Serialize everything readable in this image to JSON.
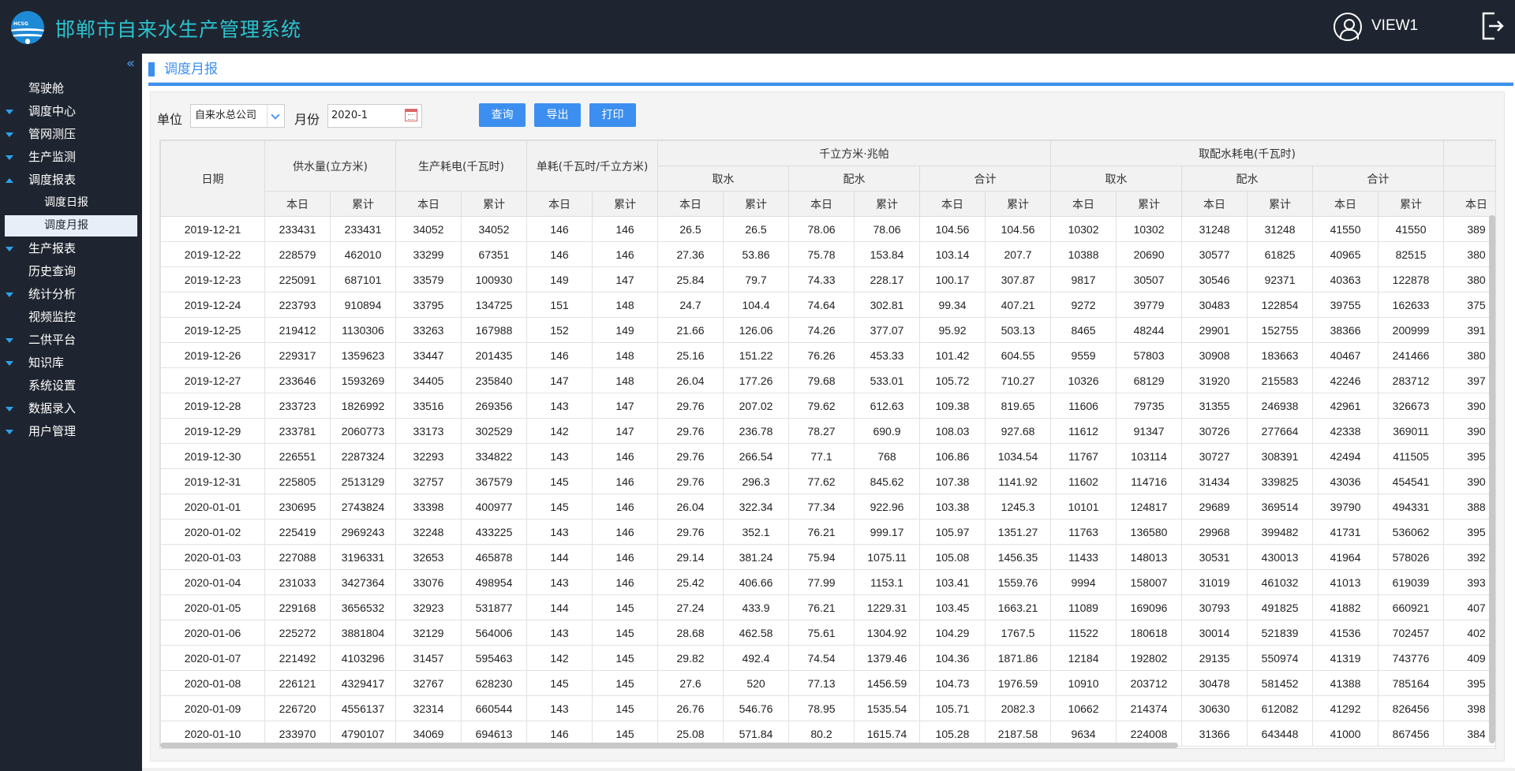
{
  "header": {
    "title": "邯郸市自来水生产管理系统",
    "logo_text": "HCSG",
    "user": "VIEW1"
  },
  "sidebar": {
    "collapse_glyph": "«",
    "items": [
      {
        "label": "驾驶舱",
        "arrow": "none"
      },
      {
        "label": "调度中心",
        "arrow": "down"
      },
      {
        "label": "管网测压",
        "arrow": "down"
      },
      {
        "label": "生产监测",
        "arrow": "down"
      },
      {
        "label": "调度报表",
        "arrow": "up"
      },
      {
        "label": "调度日报",
        "sub": true
      },
      {
        "label": "调度月报",
        "sub": true,
        "active": true
      },
      {
        "label": "生产报表",
        "arrow": "down"
      },
      {
        "label": "历史查询",
        "arrow": "none"
      },
      {
        "label": "统计分析",
        "arrow": "down"
      },
      {
        "label": "视频监控",
        "arrow": "none"
      },
      {
        "label": "二供平台",
        "arrow": "down"
      },
      {
        "label": "知识库",
        "arrow": "down"
      },
      {
        "label": "系统设置",
        "arrow": "none"
      },
      {
        "label": "数据录入",
        "arrow": "down"
      },
      {
        "label": "用户管理",
        "arrow": "down"
      }
    ]
  },
  "page": {
    "title": "调度月报"
  },
  "toolbar": {
    "unit_label": "单位",
    "unit_value": "自来水总公司",
    "month_label": "月份",
    "month_value": "2020-1",
    "query_btn": "查询",
    "export_btn": "导出",
    "print_btn": "打印"
  },
  "table": {
    "h1": {
      "date": "日期",
      "supply": "供水量(立方米)",
      "power": "生产耗电(千瓦时)",
      "unit_cons": "单耗(千瓦时/千立方米)",
      "kvm": "千立方米·兆帕",
      "water_power": "取配水耗电(千瓦时)"
    },
    "h2": {
      "take": "取水",
      "dist": "配水",
      "total": "合计"
    },
    "h3": {
      "day": "本日",
      "cum": "累计"
    },
    "rows": [
      [
        "2019-12-21",
        "233431",
        "233431",
        "34052",
        "34052",
        "146",
        "146",
        "26.5",
        "26.5",
        "78.06",
        "78.06",
        "104.56",
        "104.56",
        "10302",
        "10302",
        "31248",
        "31248",
        "41550",
        "41550",
        "389"
      ],
      [
        "2019-12-22",
        "228579",
        "462010",
        "33299",
        "67351",
        "146",
        "146",
        "27.36",
        "53.86",
        "75.78",
        "153.84",
        "103.14",
        "207.7",
        "10388",
        "20690",
        "30577",
        "61825",
        "40965",
        "82515",
        "380"
      ],
      [
        "2019-12-23",
        "225091",
        "687101",
        "33579",
        "100930",
        "149",
        "147",
        "25.84",
        "79.7",
        "74.33",
        "228.17",
        "100.17",
        "307.87",
        "9817",
        "30507",
        "30546",
        "92371",
        "40363",
        "122878",
        "380"
      ],
      [
        "2019-12-24",
        "223793",
        "910894",
        "33795",
        "134725",
        "151",
        "148",
        "24.7",
        "104.4",
        "74.64",
        "302.81",
        "99.34",
        "407.21",
        "9272",
        "39779",
        "30483",
        "122854",
        "39755",
        "162633",
        "375"
      ],
      [
        "2019-12-25",
        "219412",
        "1130306",
        "33263",
        "167988",
        "152",
        "149",
        "21.66",
        "126.06",
        "74.26",
        "377.07",
        "95.92",
        "503.13",
        "8465",
        "48244",
        "29901",
        "152755",
        "38366",
        "200999",
        "391"
      ],
      [
        "2019-12-26",
        "229317",
        "1359623",
        "33447",
        "201435",
        "146",
        "148",
        "25.16",
        "151.22",
        "76.26",
        "453.33",
        "101.42",
        "604.55",
        "9559",
        "57803",
        "30908",
        "183663",
        "40467",
        "241466",
        "380"
      ],
      [
        "2019-12-27",
        "233646",
        "1593269",
        "34405",
        "235840",
        "147",
        "148",
        "26.04",
        "177.26",
        "79.68",
        "533.01",
        "105.72",
        "710.27",
        "10326",
        "68129",
        "31920",
        "215583",
        "42246",
        "283712",
        "397"
      ],
      [
        "2019-12-28",
        "233723",
        "1826992",
        "33516",
        "269356",
        "143",
        "147",
        "29.76",
        "207.02",
        "79.62",
        "612.63",
        "109.38",
        "819.65",
        "11606",
        "79735",
        "31355",
        "246938",
        "42961",
        "326673",
        "390"
      ],
      [
        "2019-12-29",
        "233781",
        "2060773",
        "33173",
        "302529",
        "142",
        "147",
        "29.76",
        "236.78",
        "78.27",
        "690.9",
        "108.03",
        "927.68",
        "11612",
        "91347",
        "30726",
        "277664",
        "42338",
        "369011",
        "390"
      ],
      [
        "2019-12-30",
        "226551",
        "2287324",
        "32293",
        "334822",
        "143",
        "146",
        "29.76",
        "266.54",
        "77.1",
        "768",
        "106.86",
        "1034.54",
        "11767",
        "103114",
        "30727",
        "308391",
        "42494",
        "411505",
        "395"
      ],
      [
        "2019-12-31",
        "225805",
        "2513129",
        "32757",
        "367579",
        "145",
        "146",
        "29.76",
        "296.3",
        "77.62",
        "845.62",
        "107.38",
        "1141.92",
        "11602",
        "114716",
        "31434",
        "339825",
        "43036",
        "454541",
        "390"
      ],
      [
        "2020-01-01",
        "230695",
        "2743824",
        "33398",
        "400977",
        "145",
        "146",
        "26.04",
        "322.34",
        "77.34",
        "922.96",
        "103.38",
        "1245.3",
        "10101",
        "124817",
        "29689",
        "369514",
        "39790",
        "494331",
        "388"
      ],
      [
        "2020-01-02",
        "225419",
        "2969243",
        "32248",
        "433225",
        "143",
        "146",
        "29.76",
        "352.1",
        "76.21",
        "999.17",
        "105.97",
        "1351.27",
        "11763",
        "136580",
        "29968",
        "399482",
        "41731",
        "536062",
        "395"
      ],
      [
        "2020-01-03",
        "227088",
        "3196331",
        "32653",
        "465878",
        "144",
        "146",
        "29.14",
        "381.24",
        "75.94",
        "1075.11",
        "105.08",
        "1456.35",
        "11433",
        "148013",
        "30531",
        "430013",
        "41964",
        "578026",
        "392"
      ],
      [
        "2020-01-04",
        "231033",
        "3427364",
        "33076",
        "498954",
        "143",
        "146",
        "25.42",
        "406.66",
        "77.99",
        "1153.1",
        "103.41",
        "1559.76",
        "9994",
        "158007",
        "31019",
        "461032",
        "41013",
        "619039",
        "393"
      ],
      [
        "2020-01-05",
        "229168",
        "3656532",
        "32923",
        "531877",
        "144",
        "145",
        "27.24",
        "433.9",
        "76.21",
        "1229.31",
        "103.45",
        "1663.21",
        "11089",
        "169096",
        "30793",
        "491825",
        "41882",
        "660921",
        "407"
      ],
      [
        "2020-01-06",
        "225272",
        "3881804",
        "32129",
        "564006",
        "143",
        "145",
        "28.68",
        "462.58",
        "75.61",
        "1304.92",
        "104.29",
        "1767.5",
        "11522",
        "180618",
        "30014",
        "521839",
        "41536",
        "702457",
        "402"
      ],
      [
        "2020-01-07",
        "221492",
        "4103296",
        "31457",
        "595463",
        "142",
        "145",
        "29.82",
        "492.4",
        "74.54",
        "1379.46",
        "104.36",
        "1871.86",
        "12184",
        "192802",
        "29135",
        "550974",
        "41319",
        "743776",
        "409"
      ],
      [
        "2020-01-08",
        "226121",
        "4329417",
        "32767",
        "628230",
        "145",
        "145",
        "27.6",
        "520",
        "77.13",
        "1456.59",
        "104.73",
        "1976.59",
        "10910",
        "203712",
        "30478",
        "581452",
        "41388",
        "785164",
        "395"
      ],
      [
        "2020-01-09",
        "226720",
        "4556137",
        "32314",
        "660544",
        "143",
        "145",
        "26.76",
        "546.76",
        "78.95",
        "1535.54",
        "105.71",
        "2082.3",
        "10662",
        "214374",
        "30630",
        "612082",
        "41292",
        "826456",
        "398"
      ],
      [
        "2020-01-10",
        "233970",
        "4790107",
        "34069",
        "694613",
        "146",
        "145",
        "25.08",
        "571.84",
        "80.2",
        "1615.74",
        "105.28",
        "2187.58",
        "9634",
        "224008",
        "31366",
        "643448",
        "41000",
        "867456",
        "384"
      ]
    ]
  }
}
